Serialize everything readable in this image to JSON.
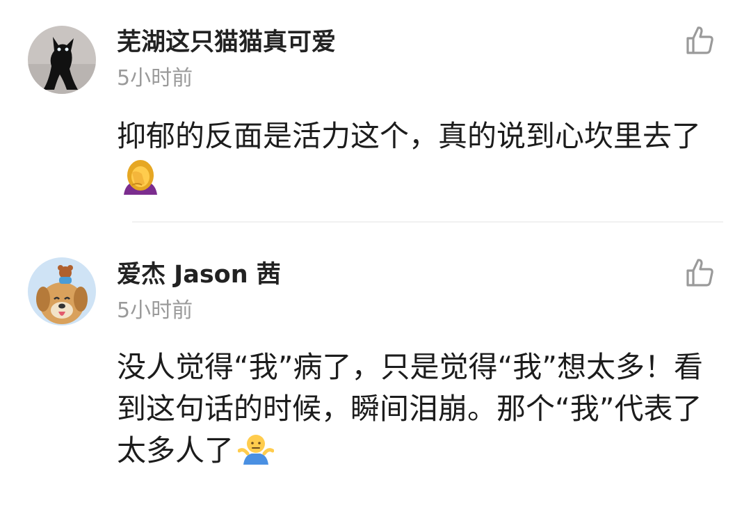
{
  "comments": [
    {
      "username": "芜湖这只猫猫真可爱",
      "time": "5小时前",
      "content": "抑郁的反面是活力这个，真的说到心坎里去了",
      "avatar_icon": "black-cat-avatar",
      "emoji_icon": "woman-facepalming-emoji",
      "like_icon": "thumbs-up-outline-icon"
    },
    {
      "username": "爱杰 Jason 茜",
      "time": "5小时前",
      "content": "没人觉得“我”病了，只是觉得“我”想太多！看到这句话的时候，瞬间泪崩。那个“我”代表了太多人了",
      "avatar_icon": "smiling-dog-avatar",
      "emoji_icon": "person-shrugging-emoji",
      "like_icon": "thumbs-up-outline-icon"
    }
  ],
  "colors": {
    "username": "#222222",
    "timestamp": "#9a9a9a",
    "content": "#1c1c1c",
    "divider": "#f1f1f1",
    "icon": "#9a9a9a"
  }
}
